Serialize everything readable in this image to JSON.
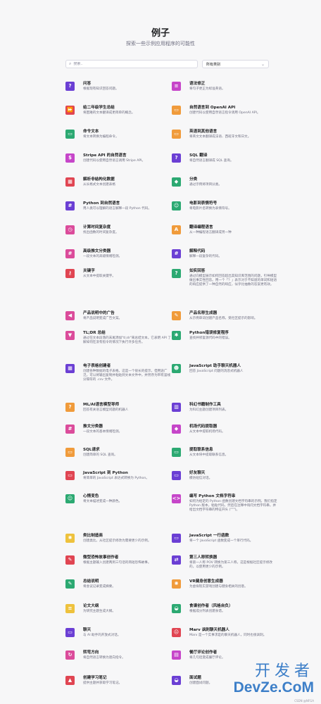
{
  "header": {
    "title": "例子",
    "subtitle": "探索一些示例应用程序的可能性"
  },
  "filters": {
    "search_placeholder": "搜索..",
    "category_value": "所有类别"
  },
  "colors": {
    "purple": "#6b3fd4",
    "pink": "#db4c9b",
    "red": "#e04552",
    "orange": "#f09b3b",
    "green": "#2ca972",
    "gold": "#eec23d",
    "magenta": "#c646c9",
    "teal": "#27a7a0"
  },
  "examples": [
    {
      "title": "问答",
      "desc": "根据现有知识回答问题。",
      "color": "#6b3fd4",
      "glyph": "?",
      "icon": "question-icon"
    },
    {
      "title": "语法修正",
      "desc": "将句子更正为标准英语。",
      "color": "#c646c9",
      "glyph": "≡",
      "icon": "text-icon"
    },
    {
      "title": "给二年级学生总结",
      "desc": "将困难的文本翻译成更简单的概念。",
      "color": "#e04552",
      "glyph": "⏩",
      "icon": "fast-forward-icon"
    },
    {
      "title": "自然语言到 OpenAI API",
      "desc": "创建代码以使用自然语言指令调用 OpenAI API。",
      "color": "#f09b3b",
      "glyph": "▭",
      "icon": "terminal-icon"
    },
    {
      "title": "命令文本",
      "desc": "将文本转换为编程命令。",
      "color": "#2ca972",
      "glyph": "▭",
      "icon": "terminal-icon"
    },
    {
      "title": "英语到其他语言",
      "desc": "将英文文本翻译成法语、西班牙文和日文。",
      "color": "#f09b3b",
      "glyph": "▭",
      "icon": "translate-icon"
    },
    {
      "title": "Stripe API 的自然语言",
      "desc": "创建代码以使用自然语言调用 Stripe API。",
      "color": "#c646c9",
      "glyph": "$",
      "icon": "dollar-icon"
    },
    {
      "title": "SQL 翻译",
      "desc": "将自然语言翻译成 SQL 查询。",
      "color": "#6b3fd4",
      "glyph": "?",
      "icon": "question-icon"
    },
    {
      "title": "解析非结构化数据",
      "desc": "从长格式文本创建表格",
      "color": "#e04552",
      "glyph": "▦",
      "icon": "table-icon"
    },
    {
      "title": "分类",
      "desc": "通过示例将项目分类。",
      "color": "#2ca972",
      "glyph": "◆",
      "icon": "tag-icon"
    },
    {
      "title": "Python 到自然语言",
      "desc": "用人类可以理解的语言解释一段 Python 代码。",
      "color": "#6b3fd4",
      "glyph": "#",
      "icon": "hash-icon"
    },
    {
      "title": "电影到表情符号",
      "desc": "将电影片名转换为表情符号。",
      "color": "#2ca972",
      "glyph": "☺",
      "icon": "smiley-icon"
    },
    {
      "title": "计算时间复杂度",
      "desc": "找出函数的时间复杂度。",
      "color": "#db4c9b",
      "glyph": "◷",
      "icon": "clock-icon"
    },
    {
      "title": "翻译编程语言",
      "desc": "从一种编程语言翻译成另一种",
      "color": "#f09b3b",
      "glyph": "A",
      "icon": "translate-icon"
    },
    {
      "title": "高级推文分类器",
      "desc": "一段文本的高级情绪检测。",
      "color": "#db4c9b",
      "glyph": "#",
      "icon": "hash-icon"
    },
    {
      "title": "解释代码",
      "desc": "解释一段复杂的代码。",
      "color": "#6b3fd4",
      "glyph": "#",
      "icon": "hash-icon"
    },
    {
      "title": "关键字",
      "desc": "从文本中提取关键字。",
      "color": "#e04552",
      "glyph": "⚷",
      "icon": "key-icon"
    },
    {
      "title": "如实回答",
      "desc": "通过向模型展示如何回答超出其知识库范围的问题，引导模型做出事实性回答。用一个「？」表示对于不知道的单词和短语的响应提供了一种自然的响应，似乎比抽象的答案更有效。",
      "color": "#2ca972",
      "glyph": "?",
      "icon": "question-icon"
    },
    {
      "title": "产品说明中的广告",
      "desc": "将产品说明变成广告文案。",
      "color": "#db4c9b",
      "glyph": "◀",
      "icon": "megaphone-icon"
    },
    {
      "title": "产品名称生成器",
      "desc": "从示例单词创建产品名称。受社区提示的影响。",
      "color": "#f09b3b",
      "glyph": "✎",
      "icon": "pencil-icon"
    },
    {
      "title": "TL;DR 总结",
      "desc": "通过在文本段落的末尾添加\"tl;dr\"来总结文本。它表明 API 了解如何在没有指令的情况下执行许多任务。",
      "color": "#db4c9b",
      "glyph": "▼",
      "icon": "filter-icon"
    },
    {
      "title": "Python错误修复程序",
      "desc": "查找并修复源代码中的错误。",
      "color": "#2ca972",
      "glyph": "✱",
      "icon": "bug-icon"
    },
    {
      "title": "电子表格创建者",
      "desc": "创建各种数据的电子表格。这是一个很长的提示，但用途广泛。可以将输出复制并粘贴到文本文件中，并另存为带有竖线分隔符的 .csv 文件。",
      "color": "#6b3fd4",
      "glyph": "▦",
      "icon": "spreadsheet-icon"
    },
    {
      "title": "JavaScript 助手聊天机器人",
      "desc": "回答 JavaScript 问题的消息式机器人",
      "color": "#2ca972",
      "glyph": "☻",
      "icon": "chat-bot-icon"
    },
    {
      "title": "ML/AI语言模型导师",
      "desc": "回答有关语言模型问题的机器人",
      "color": "#f09b3b",
      "glyph": "?",
      "icon": "question-icon"
    },
    {
      "title": "科幻书籍制作工具",
      "desc": "为科幻主题创建项目列表。",
      "color": "#6b3fd4",
      "glyph": "▥",
      "icon": "book-icon"
    },
    {
      "title": "推文分类器",
      "desc": "一段文本的基本情绪检测。",
      "color": "#db4c9b",
      "glyph": "#",
      "icon": "hash-icon"
    },
    {
      "title": "机场代码提取器",
      "desc": "从文本中提取机场代码。",
      "color": "#c646c9",
      "glyph": "◆",
      "icon": "tag-icon"
    },
    {
      "title": "SQL请求",
      "desc": "创建简单的 SQL 查询。",
      "color": "#f09b3b",
      "glyph": "▭",
      "icon": "terminal-icon"
    },
    {
      "title": "提取联系信息",
      "desc": "从文本块中提取联系信息。",
      "color": "#2ca972",
      "glyph": "▭",
      "icon": "contact-icon"
    },
    {
      "title": "JavaScript 到 Python",
      "desc": "将简单的 JavaScript 表达式转换为 Python。",
      "color": "#e04552",
      "glyph": "▭",
      "icon": "terminal-icon"
    },
    {
      "title": "好友聊天",
      "desc": "模仿短信对话。",
      "color": "#6b3fd4",
      "glyph": "▭",
      "icon": "chat-icon"
    },
    {
      "title": "心情变色",
      "desc": "将文本描述变成一种颜色。",
      "color": "#2ca972",
      "glyph": "☺",
      "icon": "smiley-icon"
    },
    {
      "title": "编写 Python 文档字符串",
      "desc": "如何为给定的 Python 函数创建文档字符串的示例。我们指定 Python 版本，粘贴代码，然后在注释中询问文档字符串，并给出文档字符串的特征开头 (\"\"\")。",
      "color": "#c646c9",
      "glyph": "<>",
      "icon": "code-icon"
    },
    {
      "title": "类比制造商",
      "desc": "创建类比。从社区提示修改为需要更少的示例。",
      "color": "#eec23d",
      "glyph": "✺",
      "icon": "lightbulb-icon"
    },
    {
      "title": "JavaScript 一行函数",
      "desc": "将一个 JavaScript 函数变成一个单行代码。",
      "color": "#6b3fd4",
      "glyph": "▭",
      "icon": "terminal-icon"
    },
    {
      "title": "微型恐怖故事创作者",
      "desc": "根据主题输入创建两到三句话的简短恐怖故事。",
      "color": "#e04552",
      "glyph": "✎",
      "icon": "pencil-icon"
    },
    {
      "title": "第三人称转换器",
      "desc": "将第一人称 POV 转换为第三人称。这是根据社区提示修改的，以使用更少的示例。",
      "color": "#6b3fd4",
      "glyph": "⇄",
      "icon": "swap-icon"
    },
    {
      "title": "总结说明",
      "desc": "将会议记录变成摘要。",
      "color": "#2ca972",
      "glyph": "✎",
      "icon": "notes-icon"
    },
    {
      "title": "VR健身创意生成器",
      "desc": "为虚拟现实游戏创建与健身相关的创意。",
      "color": "#f09b3b",
      "glyph": "✺",
      "icon": "lightbulb-icon"
    },
    {
      "title": "论文大纲",
      "desc": "为研究主题生成大纲。",
      "color": "#eec23d",
      "glyph": "≡",
      "icon": "document-icon"
    },
    {
      "title": "食谱创作者（风格自负）",
      "desc": "根据成分列表创建食谱。",
      "color": "#2ca972",
      "glyph": "◒",
      "icon": "recipe-icon"
    },
    {
      "title": "聊天",
      "desc": "与 AI 助手的开放式对话。",
      "color": "#6b3fd4",
      "glyph": "▭",
      "icon": "chat-icon"
    },
    {
      "title": "Marv 讽刺聊天机器人",
      "desc": "Marv 是一个实事求是的聊天机器人，同时也很讽刺。",
      "color": "#e04552",
      "glyph": "☹",
      "icon": "sad-face-icon"
    },
    {
      "title": "转弯方向",
      "desc": "将自然语言转换为逐向指令。",
      "color": "#db4c9b",
      "glyph": "↻",
      "icon": "directions-icon"
    },
    {
      "title": "餐厅评论创作者",
      "desc": "将几句话变成餐厅评论。",
      "color": "#c646c9",
      "glyph": "▤",
      "icon": "review-icon"
    },
    {
      "title": "创建学习笔记",
      "desc": "提供主题并获取学习笔记。",
      "color": "#e04552",
      "glyph": "▲",
      "icon": "study-icon"
    },
    {
      "title": "面试题",
      "desc": "创建面试问题。",
      "color": "#6b3fd4",
      "glyph": "◒",
      "icon": "interview-icon"
    }
  ],
  "watermark": {
    "main": "开发者",
    "sub": "DevZe.CoM",
    "credit": "CSDN @NFGA"
  }
}
